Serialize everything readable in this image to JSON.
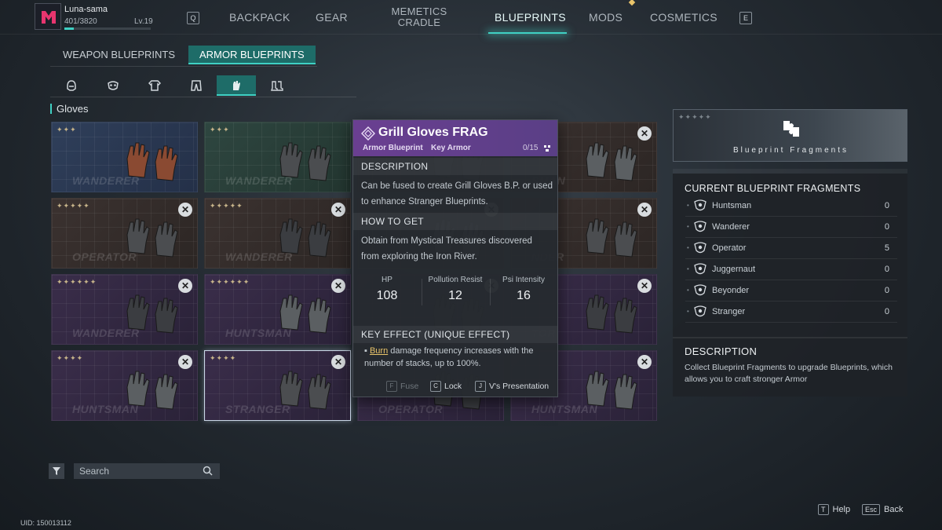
{
  "profile": {
    "name": "Luna-sama",
    "xp": "401/3820",
    "xp_progress": 0.105,
    "level": "Lv.19"
  },
  "nav": {
    "left_key": "Q",
    "right_key": "E",
    "tabs": [
      {
        "label": "BACKPACK"
      },
      {
        "label_line1": "GEAR"
      },
      {
        "label_line1": "MEMETICS",
        "label_line2": "CRADLE"
      },
      {
        "label": "BLUEPRINTS",
        "active": true
      },
      {
        "label": "MODS"
      },
      {
        "label": "COSMETICS"
      }
    ]
  },
  "subtabs": [
    {
      "label": "WEAPON BLUEPRINTS"
    },
    {
      "label": "ARMOR BLUEPRINTS",
      "active": true
    }
  ],
  "categories": [
    "helmet-icon",
    "mask-icon",
    "chest-icon",
    "pants-icon",
    "gloves-icon",
    "boots-icon"
  ],
  "active_category": "gloves-icon",
  "section_title": "Gloves",
  "cards": [
    {
      "watermark": "WANDERER",
      "stars": 3,
      "bg": "blue"
    },
    {
      "watermark": "WANDERER",
      "stars": 3,
      "bg": "green"
    },
    {
      "watermark": "",
      "stars": 0,
      "bg": "brown",
      "close": true
    },
    {
      "watermark": "SMAN",
      "stars": 0,
      "bg": "brown",
      "close": true
    },
    {
      "watermark": "OPERATOR",
      "stars": 5,
      "bg": "brown",
      "close": true
    },
    {
      "watermark": "WANDERER",
      "stars": 5,
      "bg": "brown",
      "close": true
    },
    {
      "watermark": "",
      "stars": 0,
      "bg": "brown",
      "close": true
    },
    {
      "watermark": "NDER",
      "stars": 0,
      "bg": "brown",
      "close": true
    },
    {
      "watermark": "WANDERER",
      "stars": 6,
      "bg": "purple",
      "close": true
    },
    {
      "watermark": "HUNTSMAN",
      "stars": 6,
      "bg": "purple",
      "close": true
    },
    {
      "watermark": "",
      "stars": 0,
      "bg": "purple",
      "close": true
    },
    {
      "watermark": "TOR",
      "stars": 0,
      "bg": "purple",
      "close": true
    },
    {
      "watermark": "HUNTSMAN",
      "stars": 4,
      "bg": "purple",
      "close": true
    },
    {
      "watermark": "STRANGER",
      "stars": 4,
      "bg": "purple",
      "close": true,
      "selected": true
    },
    {
      "watermark": "OPERATOR",
      "stars": 0,
      "bg": "purple"
    },
    {
      "watermark": "HUNTSMAN",
      "stars": 0,
      "bg": "purple",
      "close": true
    }
  ],
  "tooltip": {
    "title": "Grill Gloves FRAG",
    "sub1": "Armor Blueprint",
    "sub2": "Key Armor",
    "count": "0/15",
    "description_header": "DESCRIPTION",
    "description": "Can be fused to create Grill Gloves B.P. or used to enhance Stranger Blueprints.",
    "howto_header": "HOW TO GET",
    "howto": "Obtain from Mystical Treasures discovered from exploring the Iron River.",
    "stats": [
      {
        "label": "HP",
        "value": "108"
      },
      {
        "label": "Pollution Resist",
        "value": "12"
      },
      {
        "label": "Psi Intensity",
        "value": "16"
      }
    ],
    "key_effect_header": "KEY EFFECT (UNIQUE EFFECT)",
    "key_effect_highlight": "Burn",
    "key_effect_rest": " damage frequency increases with the number of stacks, up to 100%.",
    "actions": [
      {
        "key": "F",
        "label": "Fuse",
        "disabled": true
      },
      {
        "key": "C",
        "label": "Lock"
      },
      {
        "key": "J",
        "label": "V's Presentation"
      }
    ]
  },
  "fragments": {
    "banner_label": "Blueprint Fragments",
    "title": "CURRENT BLUEPRINT FRAGMENTS",
    "rows": [
      {
        "name": "Huntsman",
        "count": "0"
      },
      {
        "name": "Wanderer",
        "count": "0"
      },
      {
        "name": "Operator",
        "count": "5"
      },
      {
        "name": "Juggernaut",
        "count": "0"
      },
      {
        "name": "Beyonder",
        "count": "0"
      },
      {
        "name": "Stranger",
        "count": "0"
      }
    ],
    "desc_title": "DESCRIPTION",
    "desc_body": "Collect Blueprint Fragments to upgrade Blueprints, which allows you to craft stronger Armor"
  },
  "search": {
    "placeholder": "Search"
  },
  "uid": "UID: 150013112",
  "footer": [
    {
      "key": "T",
      "label": "Help"
    },
    {
      "key": "Esc",
      "label": "Back"
    }
  ],
  "colors": {
    "accent": "#3fd0c3",
    "tooltip_header": "#6a3f91",
    "highlight": "#e9c46a",
    "logo": "#e8356f"
  }
}
